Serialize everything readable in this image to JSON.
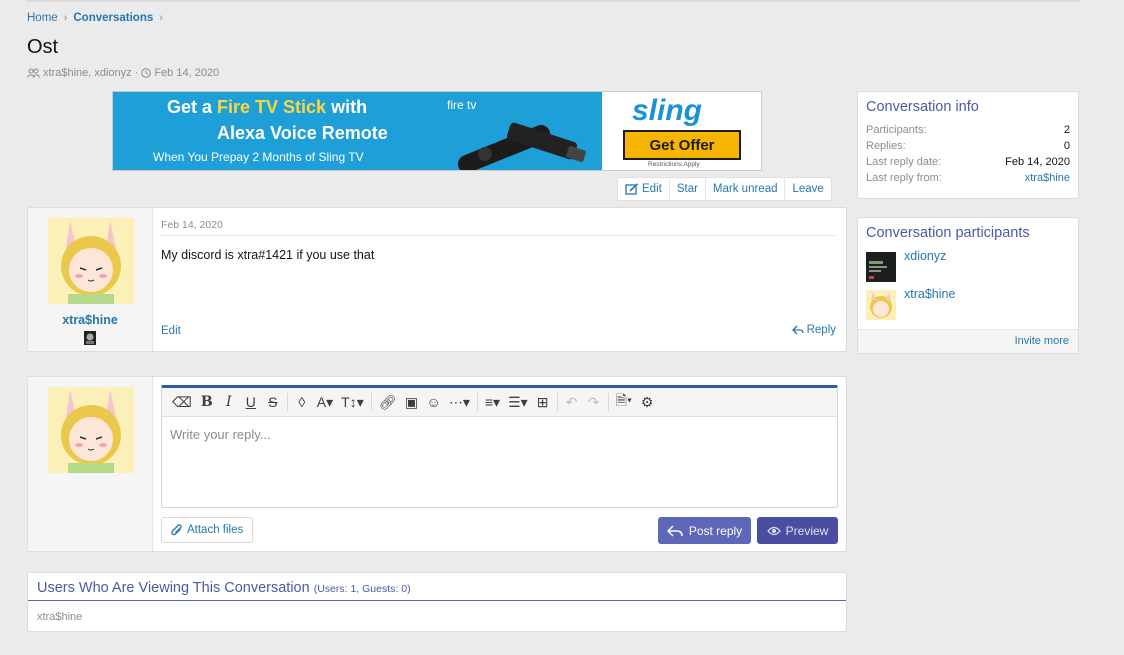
{
  "breadcrumb": {
    "home": "Home",
    "section": "Conversations",
    "sep": "›"
  },
  "page": {
    "title": "Ost",
    "participants": "xtra$hine, xdionyz",
    "date": "Feb 14, 2020"
  },
  "ad": {
    "line1_pre": "Get a ",
    "line1_hl": "Fire TV Stick",
    "line1_post": " with",
    "line2": "Alexa Voice Remote",
    "line3": "When You Prepay 2 Months of Sling TV",
    "firetv": "fire tv",
    "brand": "sling",
    "cta": "Get Offer",
    "restrictions": "Restrictions Apply"
  },
  "actions": {
    "edit": "Edit",
    "star": "Star",
    "unread": "Mark unread",
    "leave": "Leave"
  },
  "message": {
    "username": "xtra$hine",
    "date": "Feb 14, 2020",
    "body": "My discord is xtra#1421 if you use that",
    "edit": "Edit",
    "reply": "Reply"
  },
  "editor": {
    "placeholder": "Write your reply...",
    "attach": "Attach files",
    "post": "Post reply",
    "preview": "Preview"
  },
  "viewers": {
    "title": "Users Who Are Viewing This Conversation",
    "counts": "(Users: 1, Guests: 0)",
    "list": "xtra$hine"
  },
  "info": {
    "title": "Conversation info",
    "rows": [
      {
        "k": "Participants:",
        "v": "2"
      },
      {
        "k": "Replies:",
        "v": "0"
      },
      {
        "k": "Last reply date:",
        "v": "Feb 14, 2020"
      },
      {
        "k": "Last reply from:",
        "v": "xtra$hine"
      }
    ]
  },
  "participants": {
    "title": "Conversation participants",
    "items": [
      {
        "name": "xdionyz"
      },
      {
        "name": "xtra$hine"
      }
    ],
    "invite": "Invite more"
  },
  "colors": {
    "accent": "#4b5aa6",
    "link": "#2577b1",
    "button": "#5f67b8",
    "ad_bg": "#1e9fd8",
    "ad_cta": "#f7b500"
  }
}
